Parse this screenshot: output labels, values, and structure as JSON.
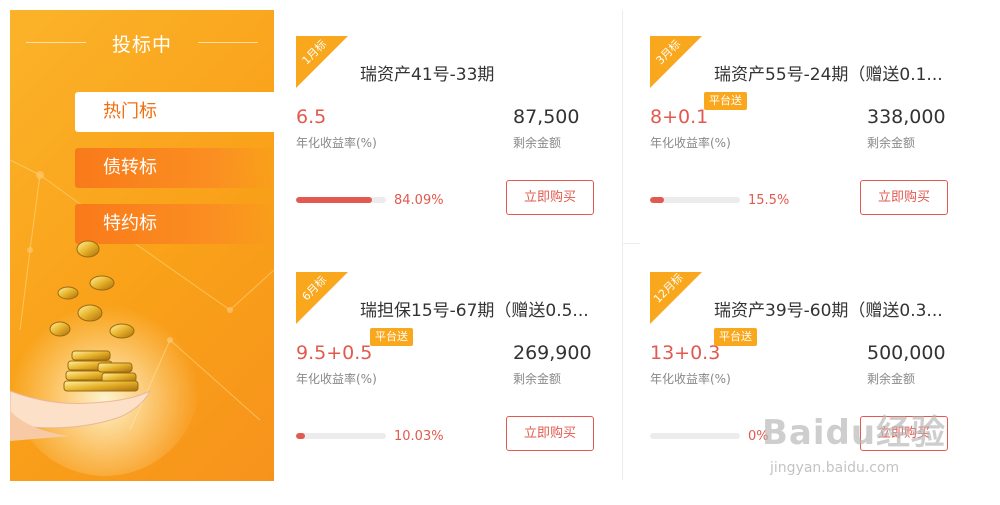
{
  "sidebar": {
    "title": "投标中",
    "tabs": [
      {
        "label": "热门标",
        "active": true
      },
      {
        "label": "债转标",
        "active": false
      },
      {
        "label": "特约标",
        "active": false
      }
    ]
  },
  "products": [
    {
      "term": "1月标",
      "name": "瑞资产41号-33期",
      "rate": "6.5",
      "badge": "",
      "rate_label": "年化收益率(%)",
      "amount": "87,500",
      "amount_label": "剩余金额",
      "progress": 84.09,
      "progress_text": "84.09%",
      "buy_label": "立即购买"
    },
    {
      "term": "3月标",
      "name": "瑞资产55号-24期（赠送0.1...",
      "rate": "8+0.1",
      "badge": "平台送",
      "rate_label": "年化收益率(%)",
      "amount": "338,000",
      "amount_label": "剩余金额",
      "progress": 15.5,
      "progress_text": "15.5%",
      "buy_label": "立即购买"
    },
    {
      "term": "6月标",
      "name": "瑞担保15号-67期（赠送0.5...",
      "rate": "9.5+0.5",
      "badge": "平台送",
      "rate_label": "年化收益率(%)",
      "amount": "269,900",
      "amount_label": "剩余金额",
      "progress": 10.03,
      "progress_text": "10.03%",
      "buy_label": "立即购买"
    },
    {
      "term": "12月标",
      "name": "瑞资产39号-60期（赠送0.3...",
      "rate": "13+0.3",
      "badge": "平台送",
      "rate_label": "年化收益率(%)",
      "amount": "500,000",
      "amount_label": "剩余金额",
      "progress": 0,
      "progress_text": "0%",
      "buy_label": "立即购买"
    }
  ],
  "watermark": {
    "main": "Baidu经验",
    "sub": "jingyan.baidu.com"
  },
  "colors": {
    "accent": "#e25a4f",
    "orange": "#f9a81d"
  }
}
